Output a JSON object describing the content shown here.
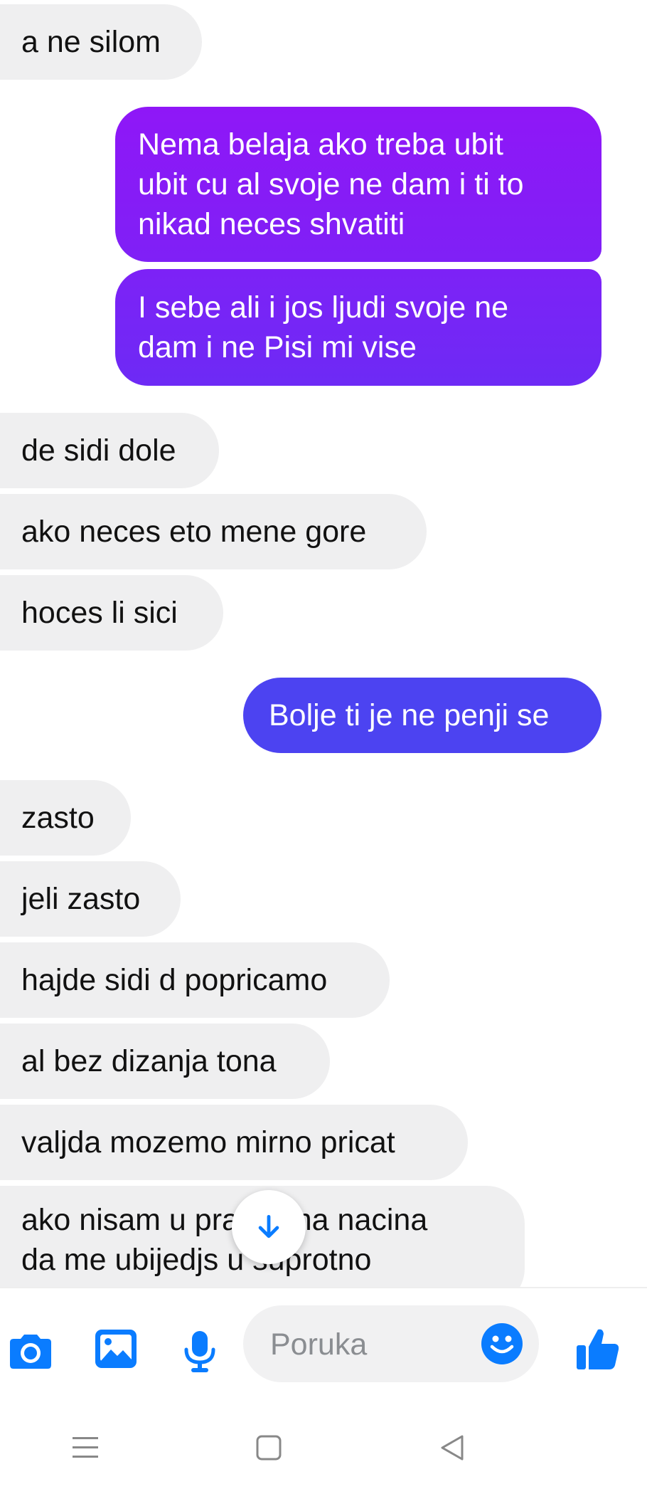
{
  "colors": {
    "incoming_bubble": "#efeff0",
    "outgoing_bubble_gradient": [
      "#8f17f7",
      "#6d2af5"
    ],
    "outgoing_bubble_blue": "#4c43f1",
    "accent": "#0a7cff"
  },
  "messages": [
    {
      "direction": "in",
      "text": "a ne silom"
    },
    {
      "direction": "out",
      "text": "Nema belaja ako treba ubit\nubit cu al svoje ne dam i ti to\nnikad neces shvatiti"
    },
    {
      "direction": "out",
      "text": "I sebe ali i jos ljudi svoje ne\ndam i ne Pisi mi vise"
    },
    {
      "direction": "in",
      "text": "de sidi dole"
    },
    {
      "direction": "in",
      "text": "ako neces eto mene gore"
    },
    {
      "direction": "in",
      "text": "hoces li sici"
    },
    {
      "direction": "out",
      "text": "Bolje ti je ne penji se"
    },
    {
      "direction": "in",
      "text": "zasto"
    },
    {
      "direction": "in",
      "text": "jeli zasto"
    },
    {
      "direction": "in",
      "text": "hajde sidi d popricamo"
    },
    {
      "direction": "in",
      "text": "al bez dizanja tona"
    },
    {
      "direction": "in",
      "text": "valjda mozemo mirno pricat"
    },
    {
      "direction": "in",
      "text": "ako nisam u pravu ima nacina\nda me ubijedjs u suprotno"
    }
  ],
  "composer": {
    "placeholder": "Poruka",
    "icons": [
      "camera-icon",
      "gallery-icon",
      "microphone-icon",
      "emoji-icon",
      "thumbs-up-icon"
    ]
  },
  "navigation": {
    "icons": [
      "menu-icon",
      "home-square-icon",
      "back-triangle-icon"
    ]
  },
  "scroll_button_icon": "arrow-down-icon"
}
